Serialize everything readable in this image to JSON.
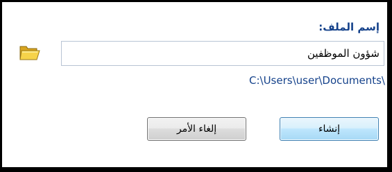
{
  "dialog": {
    "file_name_label": "إسم الملف:",
    "file_name_value": "شؤون الموظفين",
    "path": "C:\\Users\\user\\Documents\\",
    "create_button": "إنشاء",
    "cancel_button": "إلغاء الأمر",
    "browse_icon": "folder-open-icon"
  },
  "colors": {
    "label": "#15428b",
    "path": "#15428b",
    "create_border": "#3c7fb1",
    "cancel_border": "#707070"
  }
}
